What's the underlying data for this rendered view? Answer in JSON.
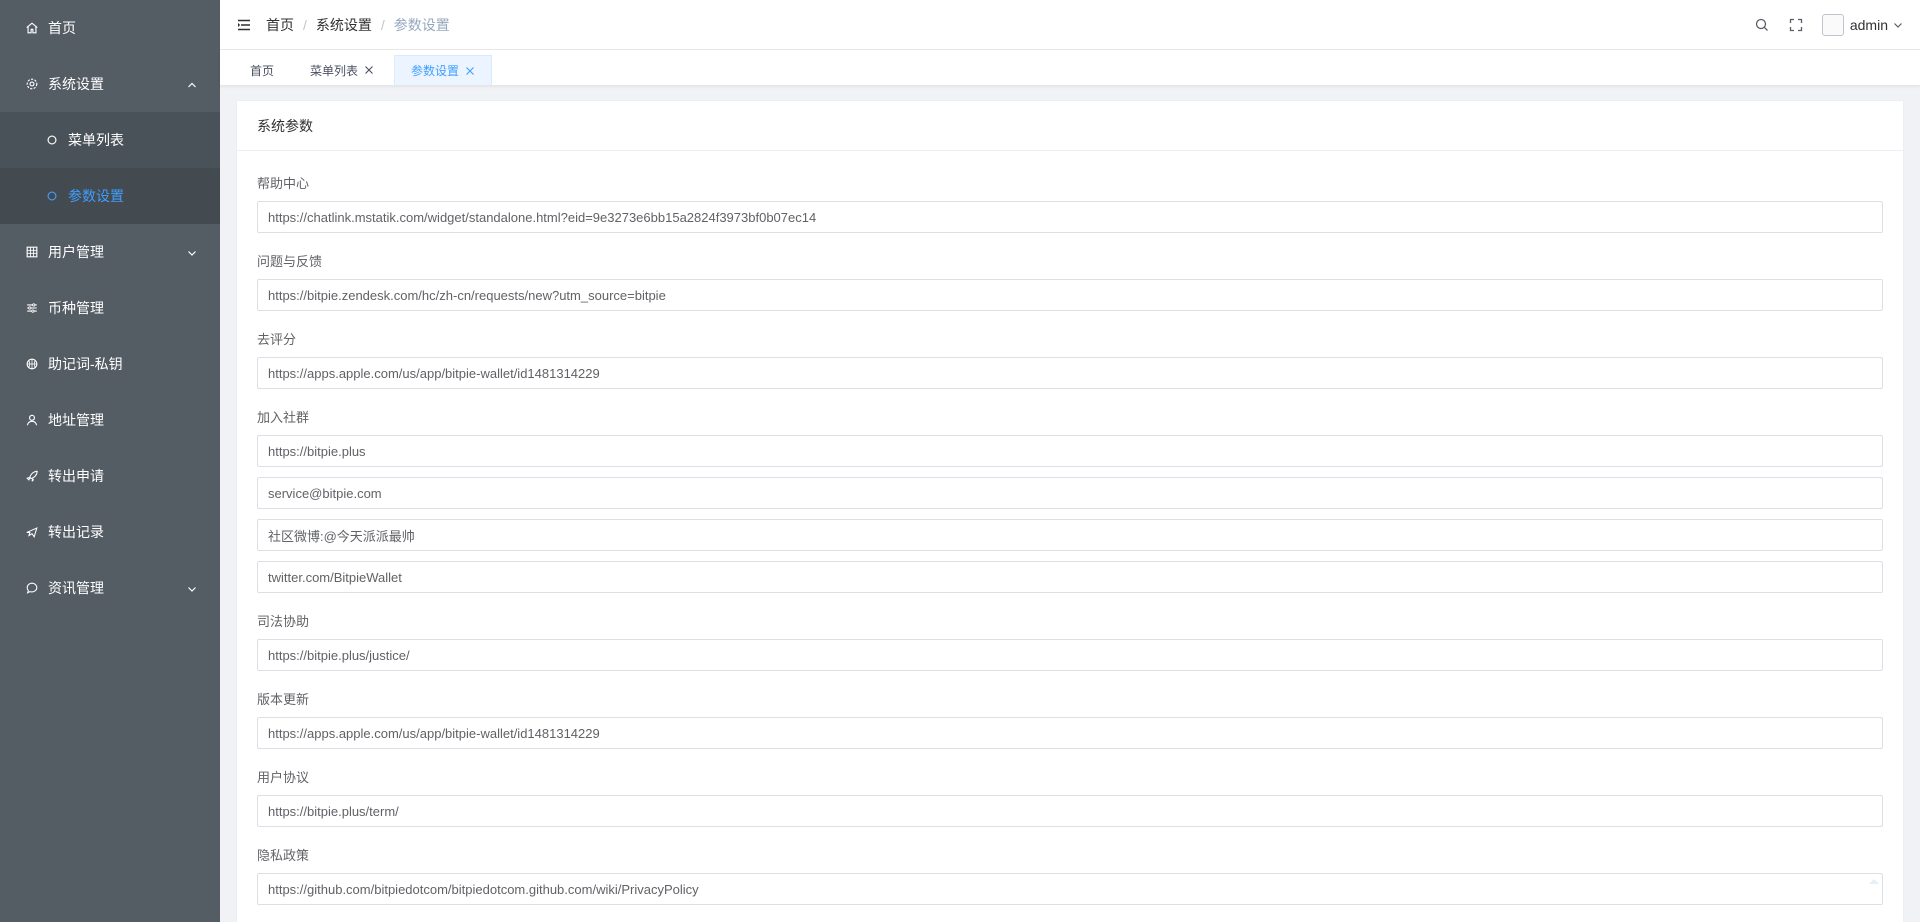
{
  "sidebar": {
    "items": [
      {
        "label": "首页",
        "icon": "home-icon"
      },
      {
        "label": "系统设置",
        "icon": "gear-icon",
        "expanded": true
      },
      {
        "label": "用户管理",
        "icon": "table-icon"
      },
      {
        "label": "币种管理",
        "icon": "sliders-icon"
      },
      {
        "label": "助记词-私钥",
        "icon": "basketball-icon"
      },
      {
        "label": "地址管理",
        "icon": "user-icon"
      },
      {
        "label": "转出申请",
        "icon": "rocket-icon"
      },
      {
        "label": "转出记录",
        "icon": "airplane-icon"
      },
      {
        "label": "资讯管理",
        "icon": "chat-icon"
      }
    ],
    "submenu": [
      {
        "label": "菜单列表",
        "icon": "circle-icon"
      },
      {
        "label": "参数设置",
        "icon": "circle-icon",
        "active": true
      }
    ],
    "active_color": "#409eff",
    "background": "#545c64"
  },
  "header": {
    "breadcrumb": [
      "首页",
      "系统设置",
      "参数设置"
    ],
    "username": "admin"
  },
  "tabs": [
    {
      "label": "首页"
    },
    {
      "label": "菜单列表"
    },
    {
      "label": "参数设置",
      "active": true
    }
  ],
  "card": {
    "title": "系统参数",
    "fields": [
      {
        "label": "帮助中心",
        "values": [
          "https://chatlink.mstatik.com/widget/standalone.html?eid=9e3273e6bb15a2824f3973bf0b07ec14"
        ]
      },
      {
        "label": "问题与反馈",
        "values": [
          "https://bitpie.zendesk.com/hc/zh-cn/requests/new?utm_source=bitpie"
        ]
      },
      {
        "label": "去评分",
        "values": [
          "https://apps.apple.com/us/app/bitpie-wallet/id1481314229"
        ]
      },
      {
        "label": "加入社群",
        "values": [
          "https://bitpie.plus",
          "service@bitpie.com",
          "社区微博:@今天派派最帅",
          "twitter.com/BitpieWallet"
        ]
      },
      {
        "label": "司法协助",
        "values": [
          "https://bitpie.plus/justice/"
        ]
      },
      {
        "label": "版本更新",
        "values": [
          "https://apps.apple.com/us/app/bitpie-wallet/id1481314229"
        ]
      },
      {
        "label": "用户协议",
        "values": [
          "https://bitpie.plus/term/"
        ]
      },
      {
        "label": "隐私政策",
        "values": [
          "https://github.com/bitpiedotcom/bitpiedotcom.github.com/wiki/PrivacyPolicy"
        ]
      }
    ]
  }
}
